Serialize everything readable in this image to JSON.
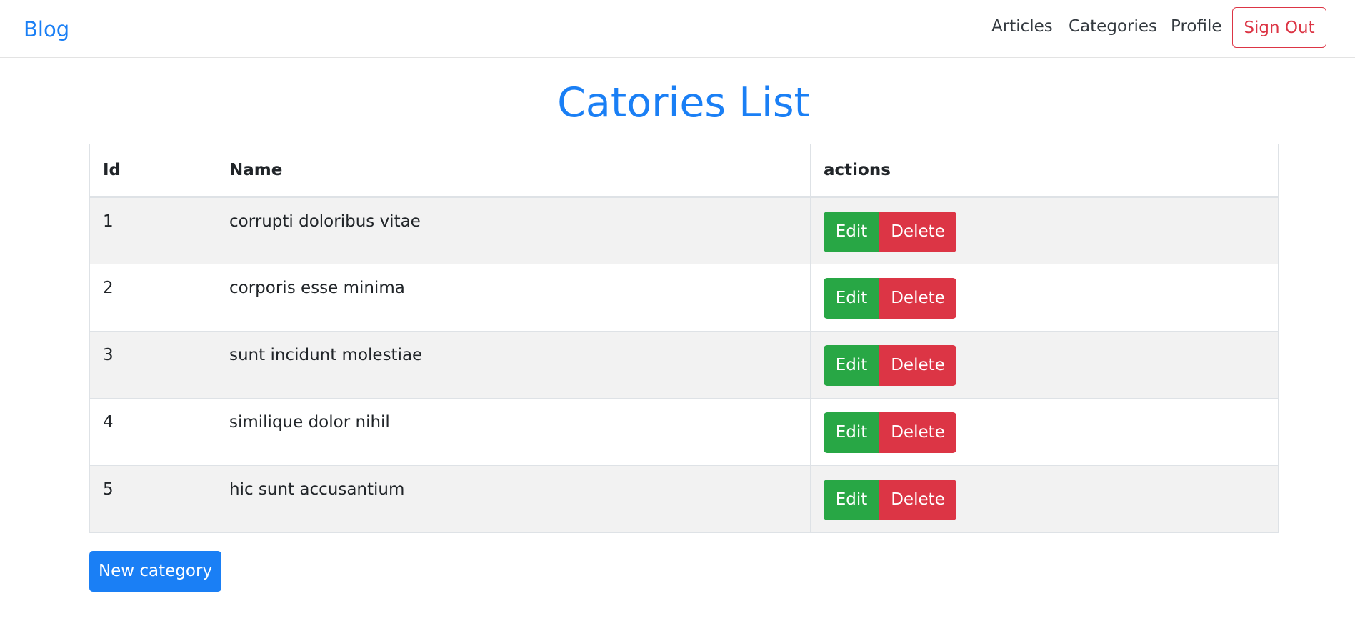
{
  "navbar": {
    "brand": "Blog",
    "links": [
      {
        "label": "Articles"
      },
      {
        "label": "Categories"
      },
      {
        "label": "Profile"
      }
    ],
    "signout_label": "Sign Out"
  },
  "page": {
    "title": "Catories List"
  },
  "table": {
    "headers": {
      "id": "Id",
      "name": "Name",
      "actions": "actions"
    },
    "rows": [
      {
        "id": "1",
        "name": "corrupti doloribus vitae"
      },
      {
        "id": "2",
        "name": "corporis esse minima"
      },
      {
        "id": "3",
        "name": "sunt incidunt molestiae"
      },
      {
        "id": "4",
        "name": "similique dolor nihil"
      },
      {
        "id": "5",
        "name": "hic sunt accusantium"
      }
    ],
    "edit_label": "Edit",
    "delete_label": "Delete"
  },
  "new_category_label": "New category",
  "colors": {
    "primary": "#1a7ff5",
    "success": "#28a745",
    "danger": "#dc3545"
  }
}
